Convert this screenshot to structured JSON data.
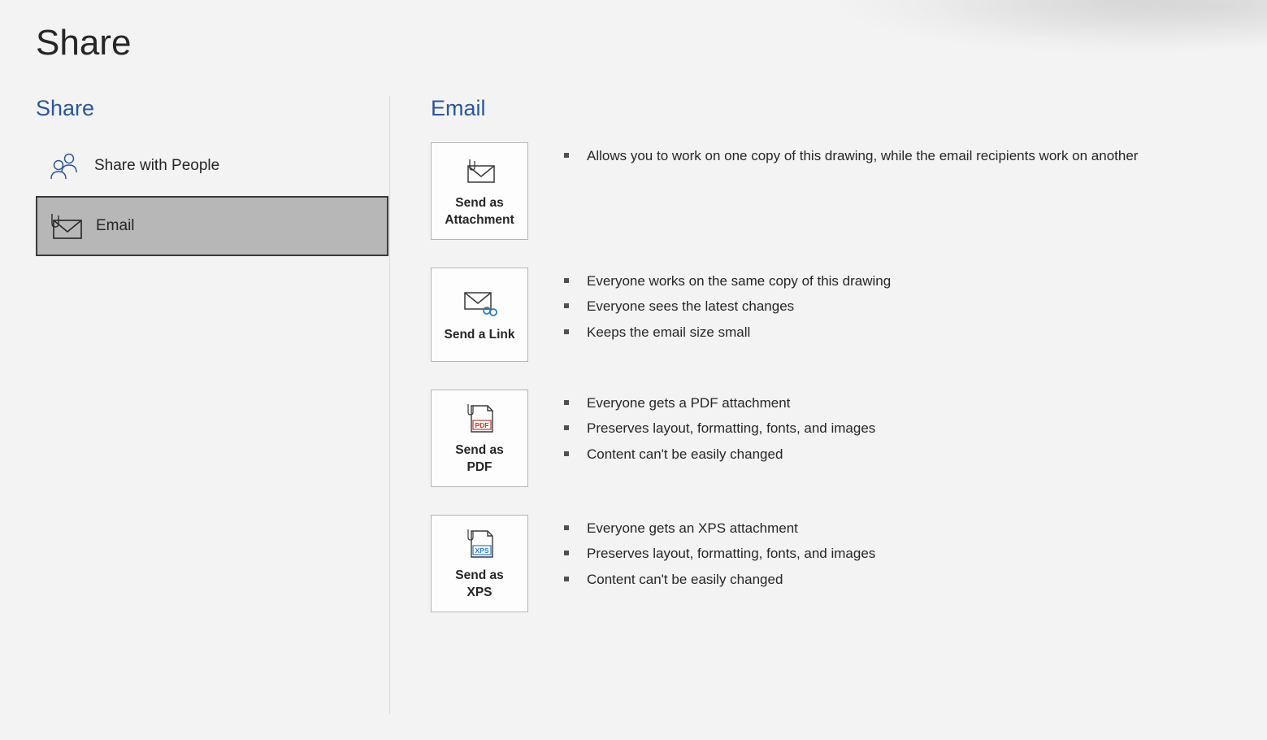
{
  "page_title": "Share",
  "left": {
    "heading": "Share",
    "options": [
      {
        "label": "Share with People"
      },
      {
        "label": "Email"
      }
    ],
    "selected_index": 1
  },
  "right": {
    "heading": "Email",
    "items": [
      {
        "button_label": "Send as\nAttachment",
        "bullets": [
          "Allows you to work on one copy of this drawing, while the email recipients work on another"
        ]
      },
      {
        "button_label": "Send a Link",
        "bullets": [
          "Everyone works on the same copy of this drawing",
          "Everyone sees the latest changes",
          "Keeps the email size small"
        ]
      },
      {
        "button_label": "Send as\nPDF",
        "bullets": [
          "Everyone gets a PDF attachment",
          "Preserves layout, formatting, fonts, and images",
          "Content can't be easily changed"
        ]
      },
      {
        "button_label": "Send as\nXPS",
        "bullets": [
          "Everyone gets an XPS attachment",
          "Preserves layout, formatting, fonts, and images",
          "Content can't be easily changed"
        ]
      }
    ]
  }
}
